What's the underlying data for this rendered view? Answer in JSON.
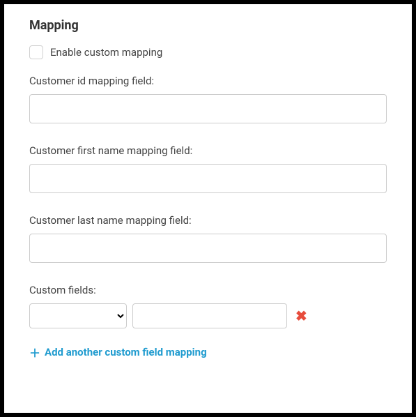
{
  "section": {
    "title": "Mapping"
  },
  "enable": {
    "label": "Enable custom mapping",
    "checked": false
  },
  "fields": {
    "customer_id": {
      "label": "Customer id mapping field:",
      "value": ""
    },
    "first_name": {
      "label": "Customer first name mapping field:",
      "value": ""
    },
    "last_name": {
      "label": "Customer last name mapping field:",
      "value": ""
    }
  },
  "custom": {
    "label": "Custom fields:",
    "rows": [
      {
        "select": "",
        "value": ""
      }
    ]
  },
  "add_link": {
    "label": "Add another custom field mapping"
  }
}
